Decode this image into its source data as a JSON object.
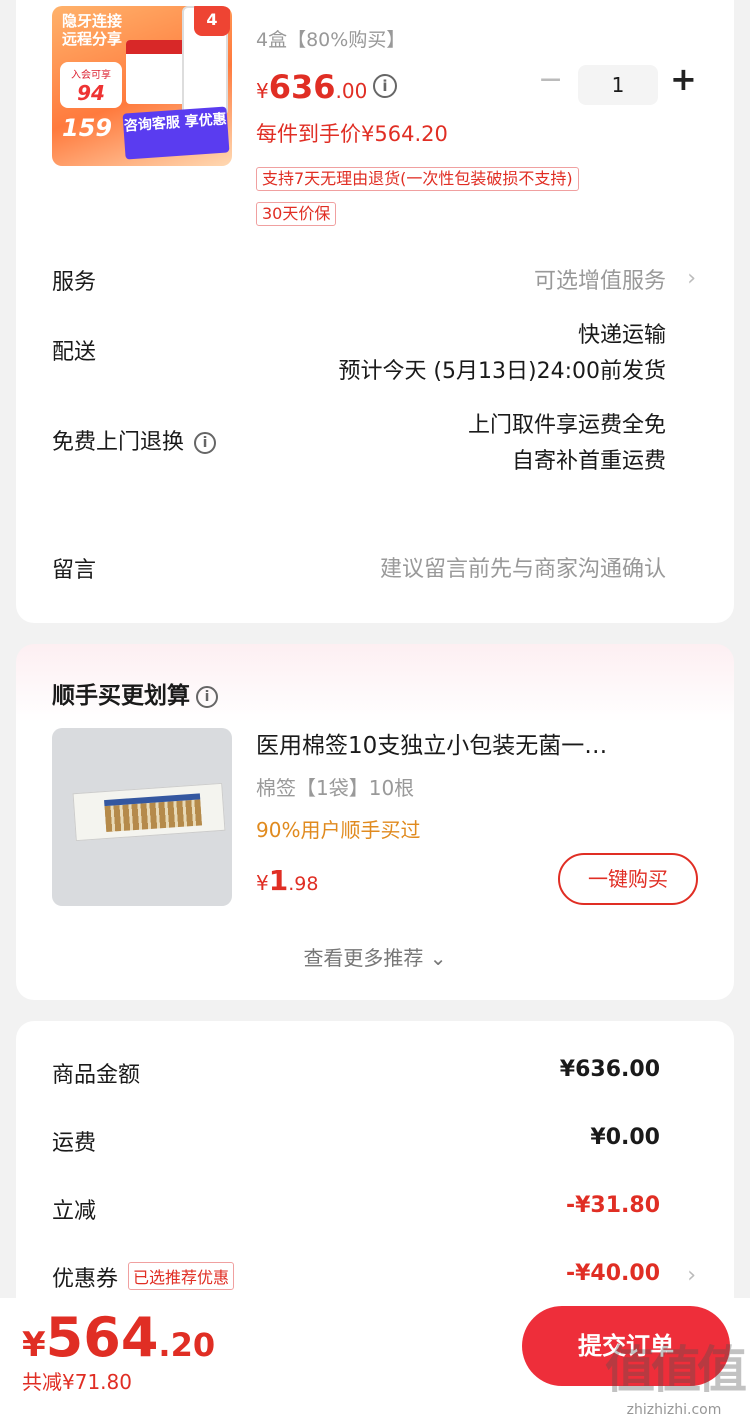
{
  "product": {
    "thumb_texts": {
      "top": "隐牙连接 远程分享",
      "join": "入会可享",
      "join_price": "94",
      "big_price": "159",
      "ask": "咨询客服 享优惠",
      "badge": "4"
    },
    "spec": "4盒【80%购买】",
    "price_yen": "¥",
    "price_int": "636",
    "price_dec": ".00",
    "quantity": "1",
    "minus_symbol": "−",
    "plus_symbol": "+",
    "unit_price": "每件到手价¥564.20",
    "tags": [
      "支持7天无理由退货(一次性包装破损不支持)",
      "30天价保"
    ]
  },
  "rows": {
    "service": {
      "label": "服务",
      "value": "可选增值服务"
    },
    "delivery": {
      "label": "配送",
      "value_line1": "快递运输",
      "value_line2": "预计今天 (5月13日)24:00前发货"
    },
    "return": {
      "label": "免费上门退换",
      "value_line1": "上门取件享运费全免",
      "value_line2": "自寄补首重运费"
    },
    "note": {
      "label": "留言",
      "placeholder": "建议留言前先与商家沟通确认"
    }
  },
  "reco": {
    "title": "顺手买更划算",
    "item_name": "医用棉签10支独立小包装无菌一…",
    "item_spec": "棉签【1袋】10根",
    "item_pct": "90%用户顺手买过",
    "price_yen": "¥",
    "price_int": "1",
    "price_dec": ".98",
    "buy_label": "一键购买",
    "more_label": "查看更多推荐"
  },
  "summary": {
    "goods": {
      "label": "商品金额",
      "amount": "¥636.00"
    },
    "shipping": {
      "label": "运费",
      "amount": "¥0.00"
    },
    "discount": {
      "label": "立减",
      "amount": "-¥31.80"
    },
    "coupon": {
      "label": "优惠券",
      "tag": "已选推荐优惠",
      "amount": "-¥40.00"
    }
  },
  "bottom": {
    "total_yen": "¥",
    "total_int": "564",
    "total_dec": ".20",
    "saved": "共减¥71.80",
    "submit_label": "提交订单"
  },
  "watermark": {
    "logo": "值值值",
    "url": "zhizhizhi.com"
  },
  "colors": {
    "accent": "#e02e24",
    "submit": "#ee2e3a",
    "orange": "#e08a1e"
  },
  "icons": {
    "info": "info-icon",
    "chevron": "chevron-right-icon",
    "chevron_down": "chevron-down-icon"
  }
}
